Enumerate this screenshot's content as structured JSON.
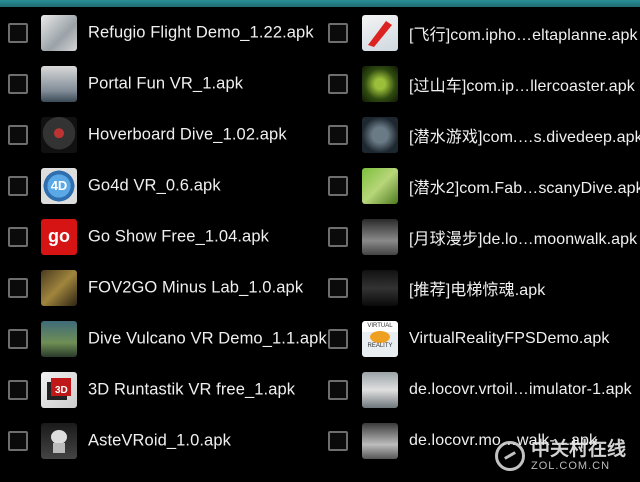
{
  "left_column": [
    {
      "label": "Refugio Flight Demo_1.22.apk",
      "icon": "refugio-app-icon"
    },
    {
      "label": "Portal Fun VR_1.apk",
      "icon": "portal-fun-app-icon"
    },
    {
      "label": "Hoverboard Dive_1.02.apk",
      "icon": "hoverboard-app-icon"
    },
    {
      "label": "Go4d VR_0.6.apk",
      "icon": "go4d-app-icon"
    },
    {
      "label": "Go Show Free_1.04.apk",
      "icon": "go-show-app-icon"
    },
    {
      "label": "FOV2GO Minus Lab_1.0.apk",
      "icon": "fov2go-app-icon"
    },
    {
      "label": "Dive Vulcano VR Demo_1.1.apk",
      "icon": "dive-vulcano-app-icon"
    },
    {
      "label": "3D Runtastik VR free_1.apk",
      "icon": "runtastik-app-icon"
    },
    {
      "label": "AsteVRoid_1.0.apk",
      "icon": "astevroid-app-icon"
    }
  ],
  "right_column": [
    {
      "label": "[飞行]com.ipho…eltaplanne.apk",
      "icon": "flight-app-icon"
    },
    {
      "label": "[过山车]com.ip…llercoaster.apk",
      "icon": "rollercoaster-app-icon"
    },
    {
      "label": "[潜水游戏]com.…s.divedeep.apk",
      "icon": "divedeep-app-icon"
    },
    {
      "label": "[潜水2]com.Fab…scanyDive.apk",
      "icon": "scanydive-app-icon"
    },
    {
      "label": "[月球漫步]de.lo…moonwalk.apk",
      "icon": "moonwalk-app-icon"
    },
    {
      "label": "[推荐]电梯惊魂.apk",
      "icon": "elevator-app-icon"
    },
    {
      "label": "VirtualRealityFPSDemo.apk",
      "icon": "vrfps-app-icon"
    },
    {
      "label": "de.locovr.vrtoil…imulator-1.apk",
      "icon": "toilet-sim-app-icon"
    },
    {
      "label": "de.locovr.mo…walk-…apk",
      "icon": "locovr-app-icon"
    }
  ],
  "icon_text": {
    "go4d": "4D",
    "goshow": "go",
    "vrfps": "VIRTUAL",
    "vrfps_bottom": "REALITY"
  },
  "watermark": {
    "cn": "中关村在线",
    "en": "ZOL.COM.CN"
  }
}
